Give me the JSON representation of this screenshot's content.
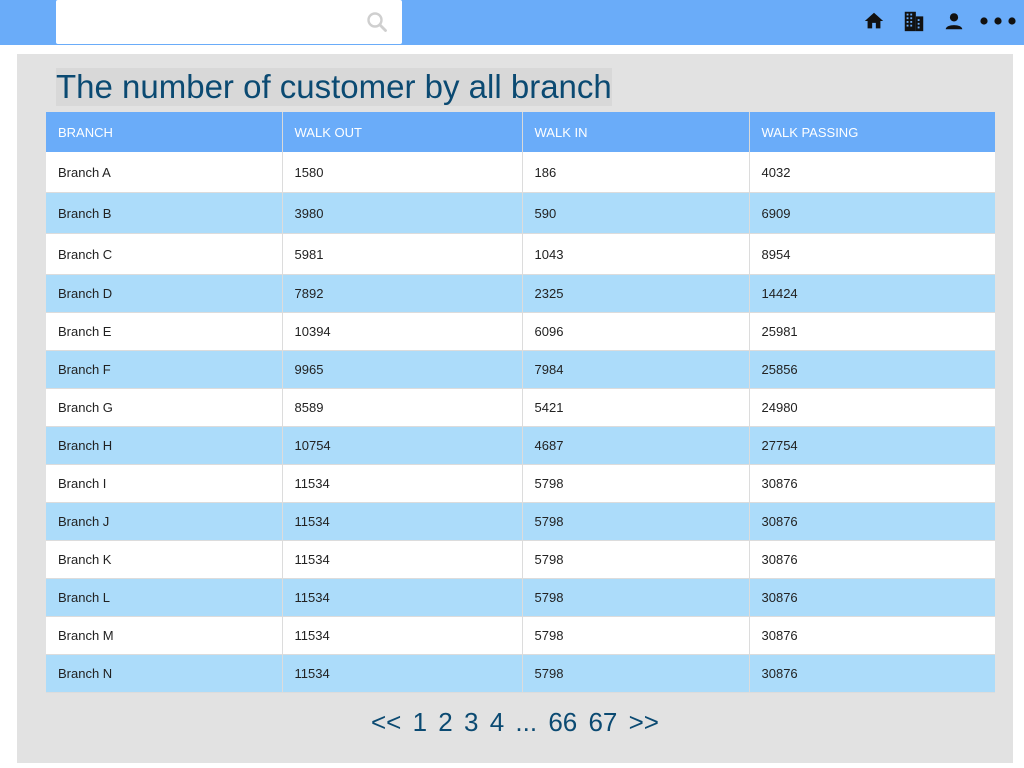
{
  "search": {
    "value": "",
    "placeholder": ""
  },
  "page": {
    "title": "The number of customer by all branch"
  },
  "table": {
    "headers": [
      "BRANCH",
      "WALK OUT",
      "WALK IN",
      "WALK PASSING"
    ],
    "rows": [
      [
        "Branch A",
        "1580",
        "186",
        "4032"
      ],
      [
        "Branch B",
        "3980",
        "590",
        "6909"
      ],
      [
        "Branch C",
        "5981",
        "1043",
        "8954"
      ],
      [
        "Branch D",
        "7892",
        "2325",
        "14424"
      ],
      [
        "Branch E",
        "10394",
        "6096",
        "25981"
      ],
      [
        "Branch F",
        "9965",
        "7984",
        "25856"
      ],
      [
        "Branch G",
        "8589",
        "5421",
        "24980"
      ],
      [
        "Branch H",
        "10754",
        "4687",
        "27754"
      ],
      [
        "Branch I",
        "11534",
        "5798",
        "30876"
      ],
      [
        "Branch J",
        "11534",
        "5798",
        "30876"
      ],
      [
        "Branch K",
        "11534",
        "5798",
        "30876"
      ],
      [
        "Branch L",
        "11534",
        "5798",
        "30876"
      ],
      [
        "Branch M",
        "11534",
        "5798",
        "30876"
      ],
      [
        "Branch N",
        "11534",
        "5798",
        "30876"
      ]
    ]
  },
  "pagination": {
    "prev": "<<",
    "pages": [
      "1",
      "2",
      "3",
      "4"
    ],
    "ellipsis": "...",
    "last_pages": [
      "66",
      "67"
    ],
    "next": ">>"
  },
  "icons": {
    "search": "search-icon",
    "home": "home-icon",
    "building": "building-icon",
    "user": "user-icon",
    "more": "more-icon"
  },
  "colors": {
    "topbar": "#6aacf9",
    "header": "#6aacf9",
    "row_alt": "#acdcfa",
    "title_text": "#0b4a72",
    "panel": "#e2e2e2"
  }
}
